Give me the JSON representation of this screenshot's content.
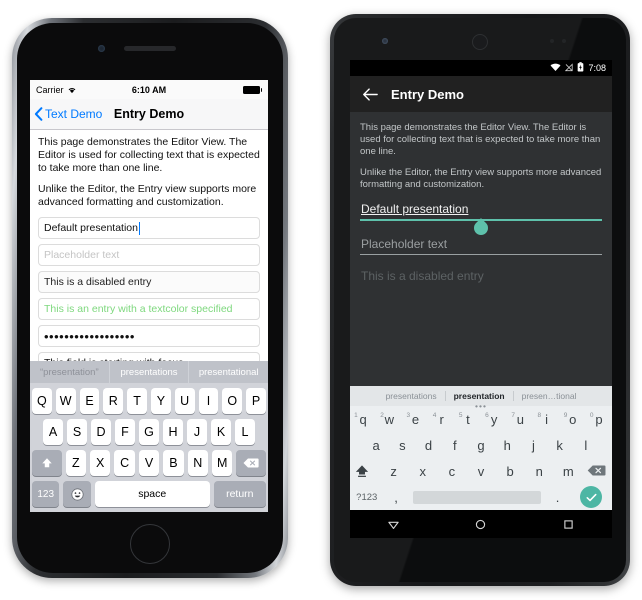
{
  "ios": {
    "status": {
      "carrier": "Carrier",
      "wifi_icon": "wifi-icon",
      "time": "6:10 AM",
      "battery_icon": "battery-full-icon"
    },
    "nav": {
      "back_label": "Text Demo",
      "back_icon": "chevron-left-icon",
      "title": "Entry Demo"
    },
    "paragraphs": [
      "This page demonstrates the Editor View. The Editor is used for collecting text that is expected to take more than one line.",
      "Unlike the Editor, the Entry view supports more advanced formatting and customization."
    ],
    "entries": [
      {
        "name": "default-presentation-entry",
        "value": "Default presentation",
        "kind": "default"
      },
      {
        "name": "placeholder-entry",
        "value": "Placeholder text",
        "kind": "placeholder"
      },
      {
        "name": "disabled-entry",
        "value": "This is a disabled entry",
        "kind": "disabled"
      },
      {
        "name": "textcolor-entry",
        "value": "This is an entry with a textcolor specified",
        "kind": "green"
      },
      {
        "name": "password-entry",
        "value": "••••••••••••••••••",
        "kind": "password"
      },
      {
        "name": "focused-entry",
        "value": "This field is starting with focus.",
        "kind": "default"
      }
    ],
    "keyboard": {
      "suggestions": [
        "“presentation”",
        "presentations",
        "presentational"
      ],
      "row1": [
        "Q",
        "W",
        "E",
        "R",
        "T",
        "Y",
        "U",
        "I",
        "O",
        "P"
      ],
      "row2": [
        "A",
        "S",
        "D",
        "F",
        "G",
        "H",
        "J",
        "K",
        "L"
      ],
      "row3": [
        "Z",
        "X",
        "C",
        "V",
        "B",
        "N",
        "M"
      ],
      "shift_icon": "shift-arrow-icon",
      "delete_icon": "backspace-icon",
      "num_label": "123",
      "emoji_icon": "emoji-smiley-icon",
      "space_label": "space",
      "return_label": "return"
    }
  },
  "android": {
    "status": {
      "wifi_icon": "wifi-icon",
      "signal_icon": "no-signal-icon",
      "battery_icon": "battery-charging-icon",
      "time": "7:08"
    },
    "appbar": {
      "back_icon": "arrow-left-icon",
      "title": "Entry Demo"
    },
    "paragraphs": [
      "This page demonstrates the Editor View. The Editor is used for collecting text that is expected to take more than one line.",
      "Unlike the Editor, the Entry view supports more advanced formatting and customization."
    ],
    "entries": [
      {
        "name": "default-presentation-entry",
        "value": "Default presentation",
        "underlined_word": "presentation",
        "kind": "focused"
      },
      {
        "name": "placeholder-entry",
        "value": "Placeholder text",
        "kind": "placeholder"
      },
      {
        "name": "disabled-entry",
        "value": "This is a disabled entry",
        "kind": "disabled"
      }
    ],
    "keyboard": {
      "suggestions": [
        "presentations",
        "presentation",
        "presen…tional"
      ],
      "selected_suggestion_index": 1,
      "more_icon": "overflow-dots-icon",
      "row1": [
        "q",
        "w",
        "e",
        "r",
        "t",
        "y",
        "u",
        "i",
        "o",
        "p"
      ],
      "row1_numbers": [
        "1",
        "2",
        "3",
        "4",
        "5",
        "6",
        "7",
        "8",
        "9",
        "0"
      ],
      "row2": [
        "a",
        "s",
        "d",
        "f",
        "g",
        "h",
        "j",
        "k",
        "l"
      ],
      "row3": [
        "z",
        "x",
        "c",
        "v",
        "b",
        "n",
        "m"
      ],
      "shift_icon": "shift-caps-icon",
      "delete_icon": "backspace-icon",
      "symbols_label": "?123",
      "comma_label": ",",
      "period_label": ".",
      "enter_icon": "check-icon"
    },
    "navbar": {
      "back_icon": "nav-back-triangle-icon",
      "home_icon": "nav-home-circle-icon",
      "recents_icon": "nav-recents-square-icon"
    }
  },
  "colors": {
    "ios_accent": "#007aff",
    "ios_green_text": "#7ed87e",
    "android_accent": "#5ec1ab",
    "android_enter": "#4db6a4",
    "android_bg": "#2f3133",
    "android_appbar": "#212121"
  }
}
